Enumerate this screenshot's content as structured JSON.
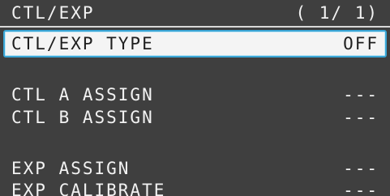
{
  "header": {
    "title": "CTL/EXP",
    "page": "( 1/ 1)"
  },
  "params": [
    {
      "label": "CTL/EXP TYPE",
      "value": "OFF",
      "selected": true
    },
    {
      "label": "CTL A ASSIGN",
      "value": "---",
      "selected": false
    },
    {
      "label": "CTL B ASSIGN",
      "value": "---",
      "selected": false
    },
    {
      "label": "EXP ASSIGN",
      "value": "---",
      "selected": false
    },
    {
      "label": "EXP CALIBRATE",
      "value": "---",
      "selected": false
    }
  ],
  "colors": {
    "background": "#3f3f3f",
    "text": "#f2f2f2",
    "selection_border": "#3aa6d6",
    "selection_fill": "#f4f4f4"
  }
}
